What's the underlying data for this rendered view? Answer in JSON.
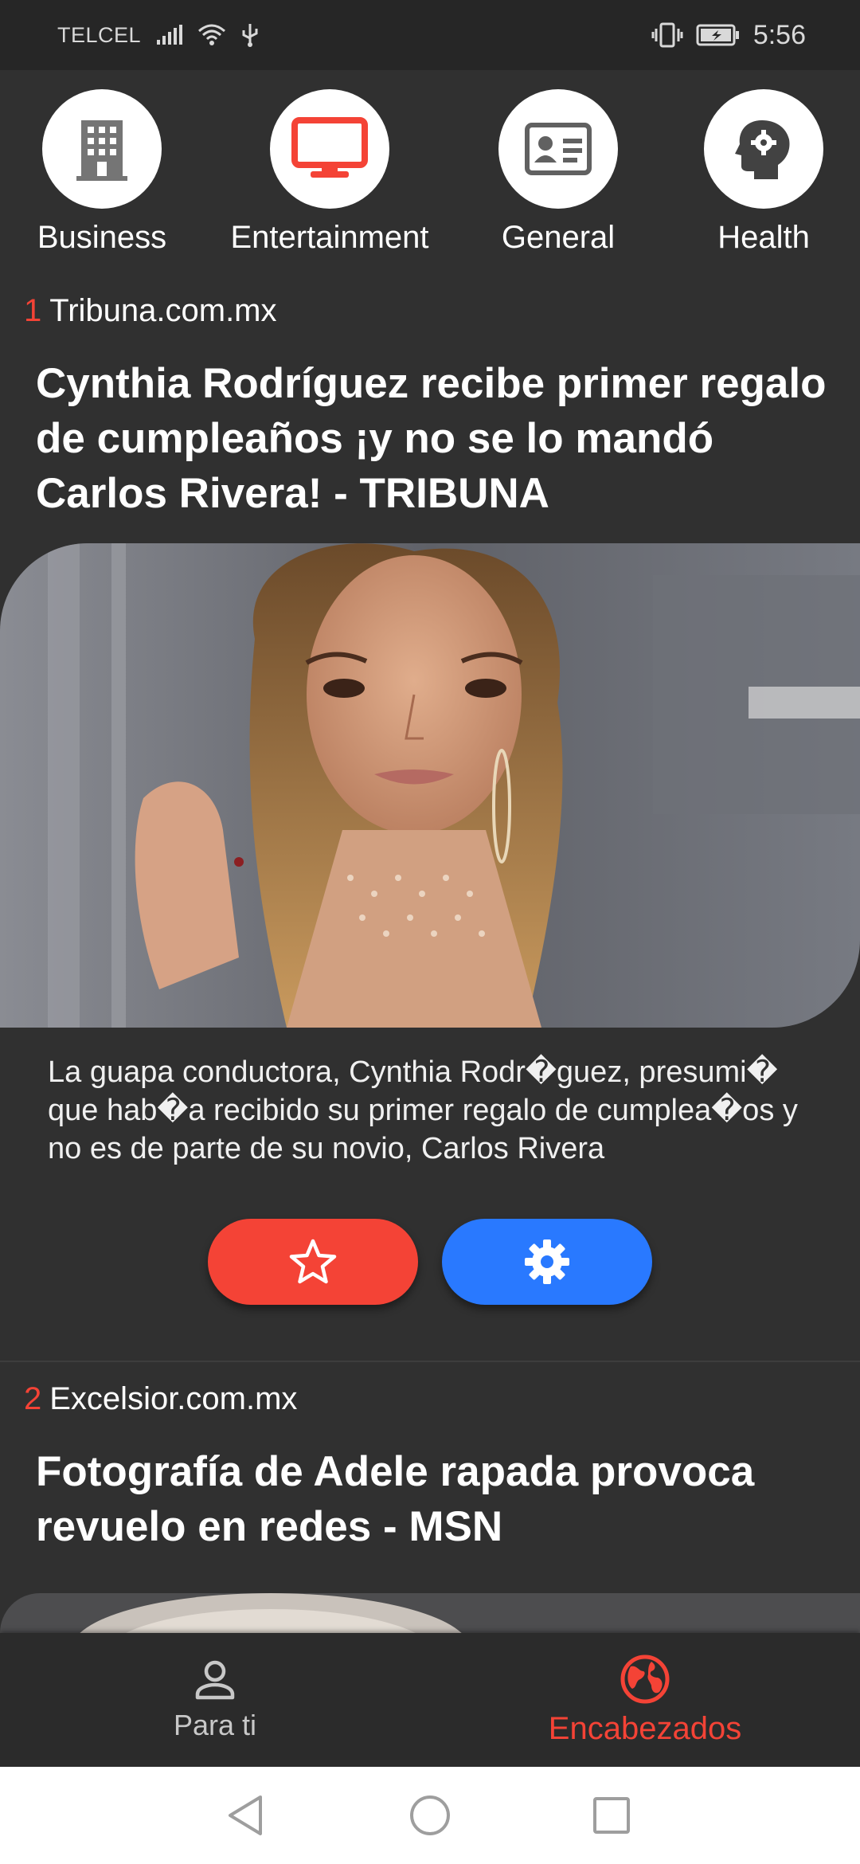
{
  "status_bar": {
    "carrier": "TELCEL",
    "time": "5:56",
    "icons": [
      "signal-icon",
      "wifi-icon",
      "usb-icon",
      "vibrate-icon",
      "battery-icon"
    ]
  },
  "categories": [
    {
      "label": "Business",
      "icon": "building-icon",
      "color": "#757575"
    },
    {
      "label": "Entertainment",
      "icon": "monitor-icon",
      "color": "#f44336"
    },
    {
      "label": "General",
      "icon": "id-card-icon",
      "color": "#616161"
    },
    {
      "label": "Health",
      "icon": "brain-gear-icon",
      "color": "#424242"
    }
  ],
  "articles": [
    {
      "rank": "1",
      "source": "Tribuna.com.mx",
      "headline": "Cynthia Rodríguez recibe primer regalo de cumpleaños ¡y no se lo mandó Carlos Rivera! - TRIBUNA",
      "description": "La guapa conductora, Cynthia Rodr�guez, presumi� que hab�a recibido su primer regalo de cumplea�os y no es de parte de su novio, Carlos Rivera",
      "image": "woman-portrait-photo"
    },
    {
      "rank": "2",
      "source": "Excelsior.com.mx",
      "headline": "Fotografía de Adele rapada provoca revuelo en redes - MSN",
      "image": "portrait-photo"
    }
  ],
  "actions": {
    "favorite_icon": "star-icon",
    "settings_icon": "gear-icon"
  },
  "bottom_nav": [
    {
      "label": "Para ti",
      "icon": "person-icon",
      "active": false
    },
    {
      "label": "Encabezados",
      "icon": "globe-icon",
      "active": true
    }
  ],
  "colors": {
    "accent": "#f44336",
    "secondary": "#2979ff",
    "background": "#303030"
  }
}
